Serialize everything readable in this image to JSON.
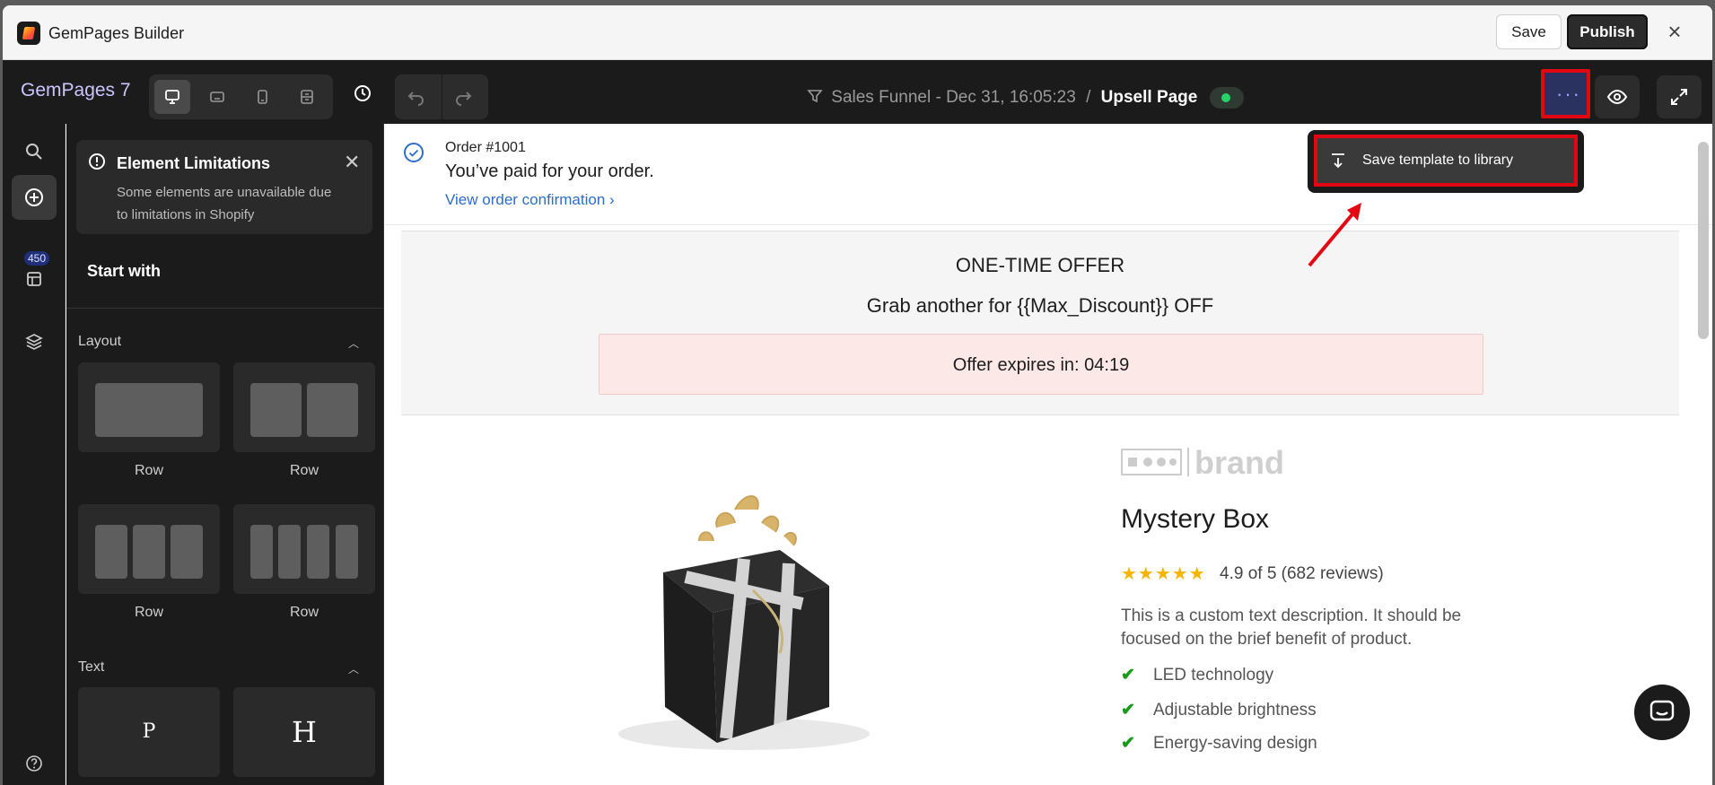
{
  "window": {
    "title": "GemPages Builder",
    "save_label": "Save",
    "publish_label": "Publish",
    "close_glyph": "×"
  },
  "toolbar": {
    "brand": "GemPages 7",
    "breadcrumb_parent": "Sales Funnel - Dec 31, 16:05:23",
    "breadcrumb_sep": "/",
    "breadcrumb_current": "Upsell Page",
    "more_glyph": "···"
  },
  "rail": {
    "badge": "450"
  },
  "panel": {
    "notice_title": "Element Limitations",
    "notice_body": "Some elements are unavailable due to limitations in Shopify",
    "start_with": "Start with",
    "layout_title": "Layout",
    "layout_tiles": [
      "Row",
      "Row",
      "Row",
      "Row"
    ],
    "text_title": "Text",
    "text_tiles": [
      "P",
      "H"
    ]
  },
  "canvas": {
    "order_number": "Order #1001",
    "order_paid": "You’ve paid for your order.",
    "order_link": "View order confirmation ›",
    "offer_title": "ONE-TIME OFFER",
    "offer_sub": "Grab another for {{Max_Discount}} OFF",
    "timer": "Offer expires in: 04:19",
    "brand_word": "brand",
    "product_title": "Mystery Box",
    "stars": "★★★★★",
    "rating": "4.9 of 5 (682 reviews)",
    "description": "This is a custom text description. It should be focused on the brief benefit of product.",
    "features": [
      "LED technology",
      "Adjustable brightness",
      "Energy-saving design"
    ]
  },
  "dropdown": {
    "item_label": "Save template to library"
  },
  "colors": {
    "accent_red": "#e30613",
    "link_blue": "#2c6ecb",
    "status_green": "#26d366",
    "star_yellow": "#f7b500"
  },
  "icons": [
    "app-logo",
    "desktop-icon",
    "tablet-icon",
    "mobile-icon",
    "layout-icon",
    "history-icon",
    "undo-icon",
    "redo-icon",
    "funnel-icon",
    "more-icon",
    "eye-icon",
    "expand-icon",
    "search-icon",
    "add-icon",
    "library-icon",
    "layers-icon",
    "help-icon",
    "info-icon",
    "close-icon",
    "check-circle-icon",
    "download-icon",
    "chat-icon"
  ]
}
